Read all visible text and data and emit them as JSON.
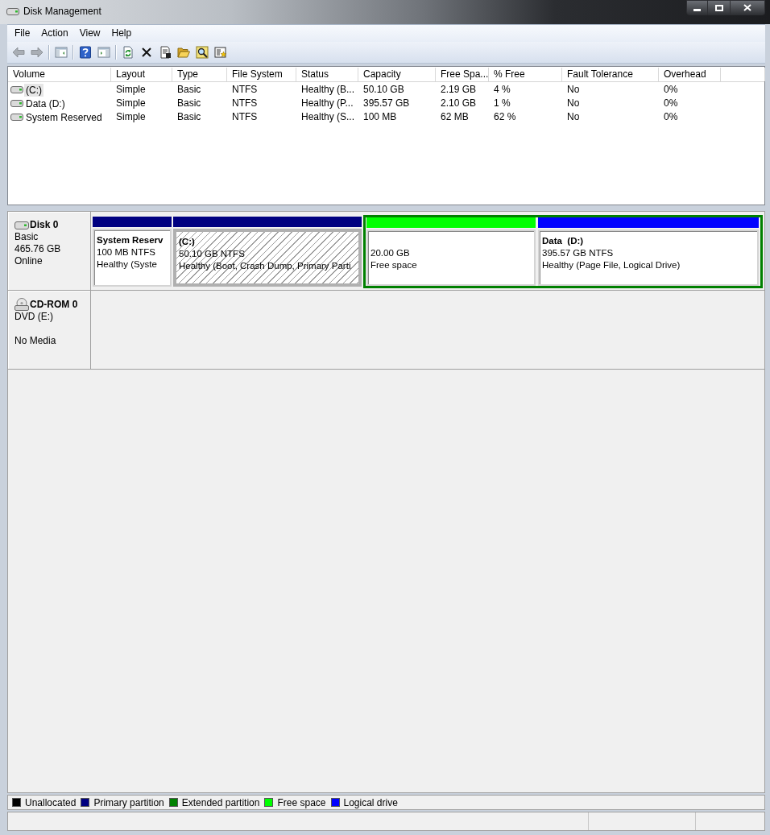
{
  "window": {
    "title": "Disk Management"
  },
  "menu": [
    "File",
    "Action",
    "View",
    "Help"
  ],
  "toolbar": [
    {
      "kind": "back",
      "disabled": true
    },
    {
      "kind": "forward",
      "disabled": true
    },
    {
      "kind": "separator"
    },
    {
      "kind": "console_tree",
      "disabled": false
    },
    {
      "kind": "separator"
    },
    {
      "kind": "help",
      "disabled": false
    },
    {
      "kind": "action_pane",
      "disabled": false
    },
    {
      "kind": "separator"
    },
    {
      "kind": "refresh",
      "disabled": false
    },
    {
      "kind": "delete",
      "disabled": false
    },
    {
      "kind": "properties",
      "disabled": false
    },
    {
      "kind": "open",
      "disabled": false
    },
    {
      "kind": "search",
      "disabled": false
    },
    {
      "kind": "wizard",
      "disabled": false
    }
  ],
  "volume_list": {
    "columns": [
      "Volume",
      "Layout",
      "Type",
      "File System",
      "Status",
      "Capacity",
      "Free Spa...",
      "% Free",
      "Fault Tolerance",
      "Overhead"
    ],
    "rows": [
      {
        "selected": true,
        "cells": [
          "(C:)",
          "Simple",
          "Basic",
          "NTFS",
          "Healthy (B...",
          "50.10 GB",
          "2.19 GB",
          "4 %",
          "No",
          "0%"
        ]
      },
      {
        "selected": false,
        "cells": [
          "Data (D:)",
          "Simple",
          "Basic",
          "NTFS",
          "Healthy (P...",
          "395.57 GB",
          "2.10 GB",
          "1 %",
          "No",
          "0%"
        ]
      },
      {
        "selected": false,
        "cells": [
          "System Reserved",
          "Simple",
          "Basic",
          "NTFS",
          "Healthy (S...",
          "100 MB",
          "62 MB",
          "62 %",
          "No",
          "0%"
        ]
      }
    ]
  },
  "disks": [
    {
      "kind": "disk",
      "name": "Disk 0",
      "type": "Basic",
      "size": "465.76 GB",
      "status": "Online",
      "partitions": [
        {
          "kind": "primary",
          "color": "#000080",
          "name": "System Reserv",
          "size": "100 MB NTFS",
          "status": "Healthy (Syste",
          "selected": false
        },
        {
          "kind": "primary",
          "color": "#000080",
          "name": "(C:)",
          "size": "50.10 GB NTFS",
          "status": "Healthy (Boot, Crash Dump, Primary Parti",
          "selected": true
        },
        {
          "kind": "extended",
          "color": "#008000",
          "children": [
            {
              "color": "#00ff00",
              "size": "20.00 GB",
              "status": "Free space",
              "selected": false
            },
            {
              "color": "#0000ff",
              "name": "Data  (D:)",
              "size": "395.57 GB NTFS",
              "status": "Healthy (Page File, Logical Drive)",
              "selected": false
            }
          ]
        }
      ]
    },
    {
      "kind": "cdrom",
      "name": "CD-ROM 0",
      "type": "DVD (E:)",
      "status": "No Media"
    }
  ],
  "legend": [
    {
      "label": "Unallocated",
      "color": "#000000"
    },
    {
      "label": "Primary partition",
      "color": "#000080"
    },
    {
      "label": "Extended partition",
      "color": "#008000"
    },
    {
      "label": "Free space",
      "color": "#00ff00"
    },
    {
      "label": "Logical drive",
      "color": "#0000ff"
    }
  ]
}
